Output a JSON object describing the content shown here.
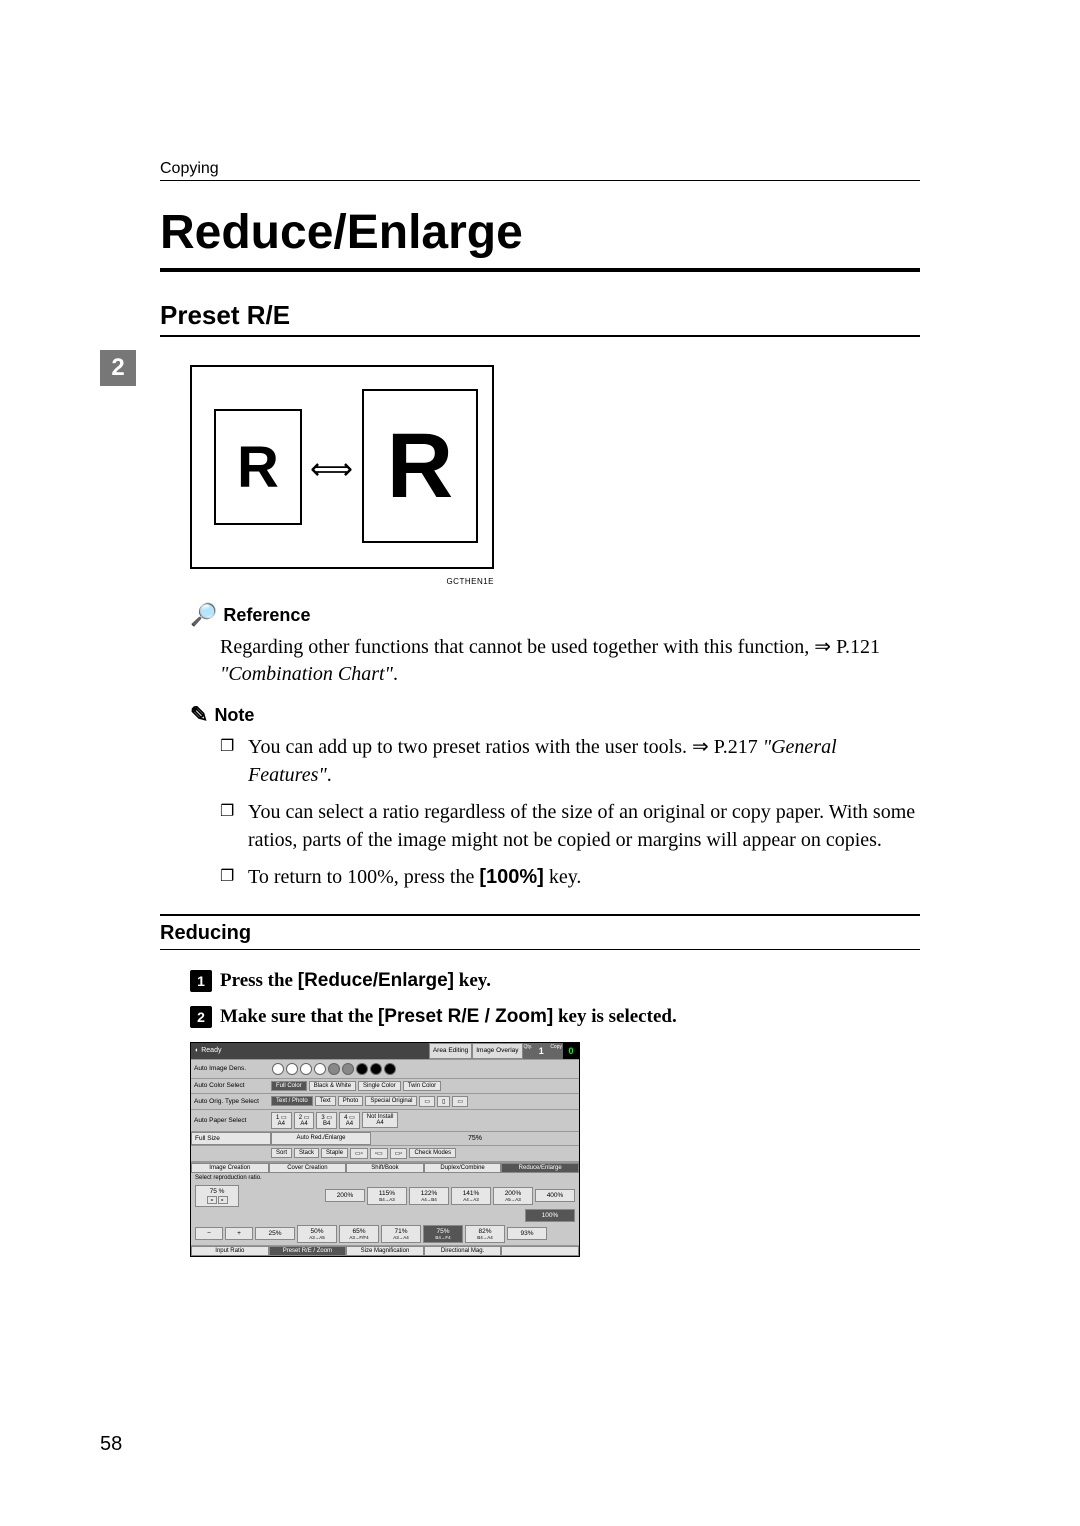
{
  "running_header": "Copying",
  "title": "Reduce/Enlarge",
  "subheading": "Preset R/E",
  "step_box": "2",
  "fig": {
    "small_R": "R",
    "large_R": "R",
    "arrow": "⟺",
    "code": "GCTHEN1E"
  },
  "reference": {
    "label": "Reference",
    "text": "Regarding other functions that cannot be used together with this function, ⇒ P.121 ",
    "italic": "\"Combination Chart\"",
    "tail": "."
  },
  "note": {
    "label": "Note",
    "items": [
      {
        "pre": "You can add up to two preset ratios with the user tools. ⇒ P.217 ",
        "italic": "\"General Features\"",
        "post": "."
      },
      {
        "pre": "You can select a ratio regardless of the size of an original or copy paper. With some ratios, parts of the image might not be copied or margins will appear on copies.",
        "italic": "",
        "post": ""
      },
      {
        "pre": "To return to 100%, press the ",
        "bold_key": "[100%]",
        "post": " key."
      }
    ]
  },
  "reducing": {
    "heading": "Reducing",
    "step1_num": "1",
    "step1_text_a": "Press the ",
    "step1_key": "[Reduce/Enlarge]",
    "step1_text_b": " key.",
    "step2_num": "2",
    "step2_text_a": "Make sure that the ",
    "step2_key": "[Preset R/E / Zoom]",
    "step2_text_b": " key is selected."
  },
  "screenshot": {
    "ready": "Ready",
    "area_editing": "Area Editing",
    "image_overlay": "Image Overlay",
    "qty_label": "Qty.",
    "qty": "1",
    "copy_label": "Copy",
    "copy_count": "0",
    "auto_image_density": "Auto Image Dens.",
    "auto_color_select": "Auto Color Select",
    "full_color": "Full Color",
    "black_white": "Black & White",
    "single_color": "Single Color",
    "twin_color": "Twin Color",
    "auto_orig_type": "Auto Orig. Type Select",
    "text_photo": "Text / Photo",
    "text": "Text",
    "photo": "Photo",
    "special_original": "Special Original",
    "auto_paper": "Auto Paper Select",
    "a4p": "A4",
    "b4p": "B4",
    "tray_not_install": "Not Install",
    "full_size": "Full Size",
    "auto_re": "Auto Red./Enlarge",
    "disp_75": "75%",
    "sort": "Sort",
    "stack": "Stack",
    "staple": "Staple",
    "check_modes": "Check Modes",
    "image_creation": "Image Creation",
    "cover_creation": "Cover Creation",
    "shift_book": "Shift/Book",
    "duplex_combine": "Duplex/Combine",
    "reduce_enlarge": "Reduce/Enlarge",
    "select_ratio": "Select reproduction ratio.",
    "input_ratio": "Input Ratio",
    "preset_re_zoom": "Preset R/E / Zoom",
    "size_mag": "Size Magnification",
    "directional_mag": "Directional Mag.",
    "ratios_top": [
      {
        "v": "75 %",
        "s": ""
      },
      {
        "v": "200%",
        "s": ""
      },
      {
        "v": "115%",
        "s": "B4→A3"
      },
      {
        "v": "122%",
        "s": "A4→B4"
      },
      {
        "v": "141%",
        "s": "A4→A3"
      },
      {
        "v": "200%",
        "s": "A5→A3"
      },
      {
        "v": "400%",
        "s": ""
      }
    ],
    "hundred": "100%",
    "minus": "−",
    "plus": "+",
    "ratios_bot": [
      {
        "v": "25%",
        "s": ""
      },
      {
        "v": "50%",
        "s": "A3→A5"
      },
      {
        "v": "65%",
        "s": "A3→F/F4"
      },
      {
        "v": "71%",
        "s": "A3→A4"
      },
      {
        "v": "75%",
        "s": "B4→F4"
      },
      {
        "v": "82%",
        "s": "B4→A4"
      },
      {
        "v": "93%",
        "s": ""
      }
    ]
  },
  "page_number": "58"
}
